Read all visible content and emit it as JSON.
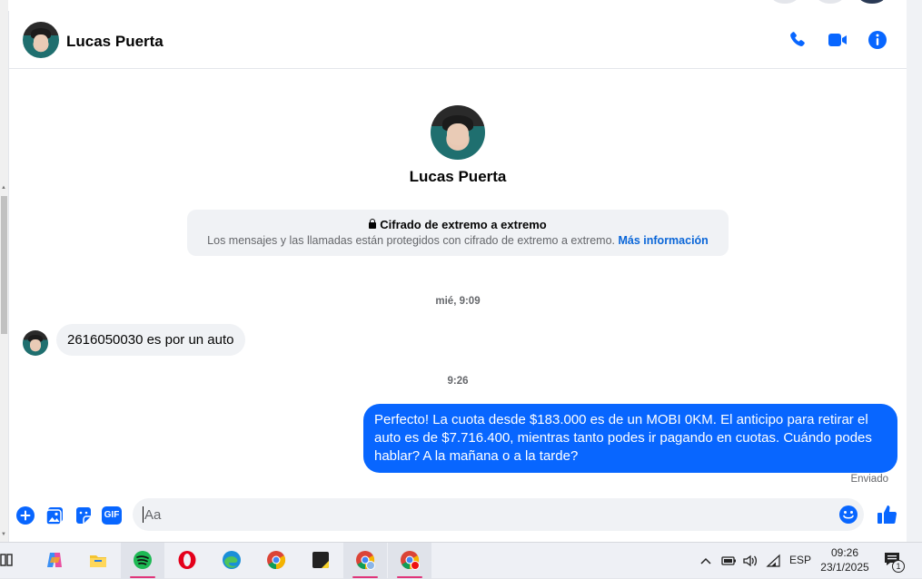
{
  "contact": {
    "name": "Lucas Puerta"
  },
  "profile": {
    "name": "Lucas Puerta"
  },
  "encryption": {
    "title": "Cifrado de extremo a extremo",
    "description": "Los mensajes y las llamadas están protegidos con cifrado de extremo a extremo.",
    "link": "Más información"
  },
  "messages": [
    {
      "timestamp": "mié, 9:09",
      "direction": "incoming",
      "text": "2616050030 es por un auto"
    },
    {
      "timestamp": "9:26",
      "direction": "outgoing",
      "text": "Perfecto! La cuota desde $183.000 es de un MOBI 0KM. El anticipo para retirar el auto es de $7.716.400, mientras tanto podes ir pagando en cuotas. Cuándo podes hablar? A la mañana o a la tarde?",
      "status": "Enviado"
    }
  ],
  "composer": {
    "placeholder": "Aa",
    "gif_label": "GIF"
  },
  "colors": {
    "accent": "#0866ff",
    "bubble_in": "#f0f2f5"
  },
  "taskbar": {
    "apps": [
      "task-view",
      "copilot",
      "file-explorer",
      "spotify",
      "opera",
      "edge",
      "chrome",
      "sticky-notes",
      "chrome",
      "chrome"
    ],
    "language": "ESP",
    "time": "09:26",
    "date": "23/1/2025",
    "notification_count": "1"
  }
}
